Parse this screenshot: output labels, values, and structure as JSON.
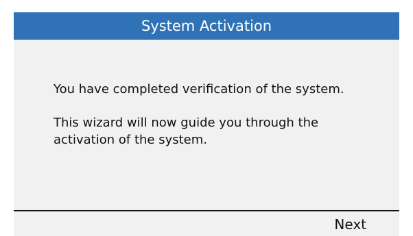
{
  "window": {
    "title": "System Activation"
  },
  "content": {
    "paragraphs": [
      "You have completed verification of the system.",
      "This wizard will now guide you through the activation of the system."
    ]
  },
  "footer": {
    "next_label": "Next"
  },
  "colors": {
    "title_bar": "#2f72b5",
    "panel_background": "#f1f1f1",
    "text": "#111111"
  }
}
